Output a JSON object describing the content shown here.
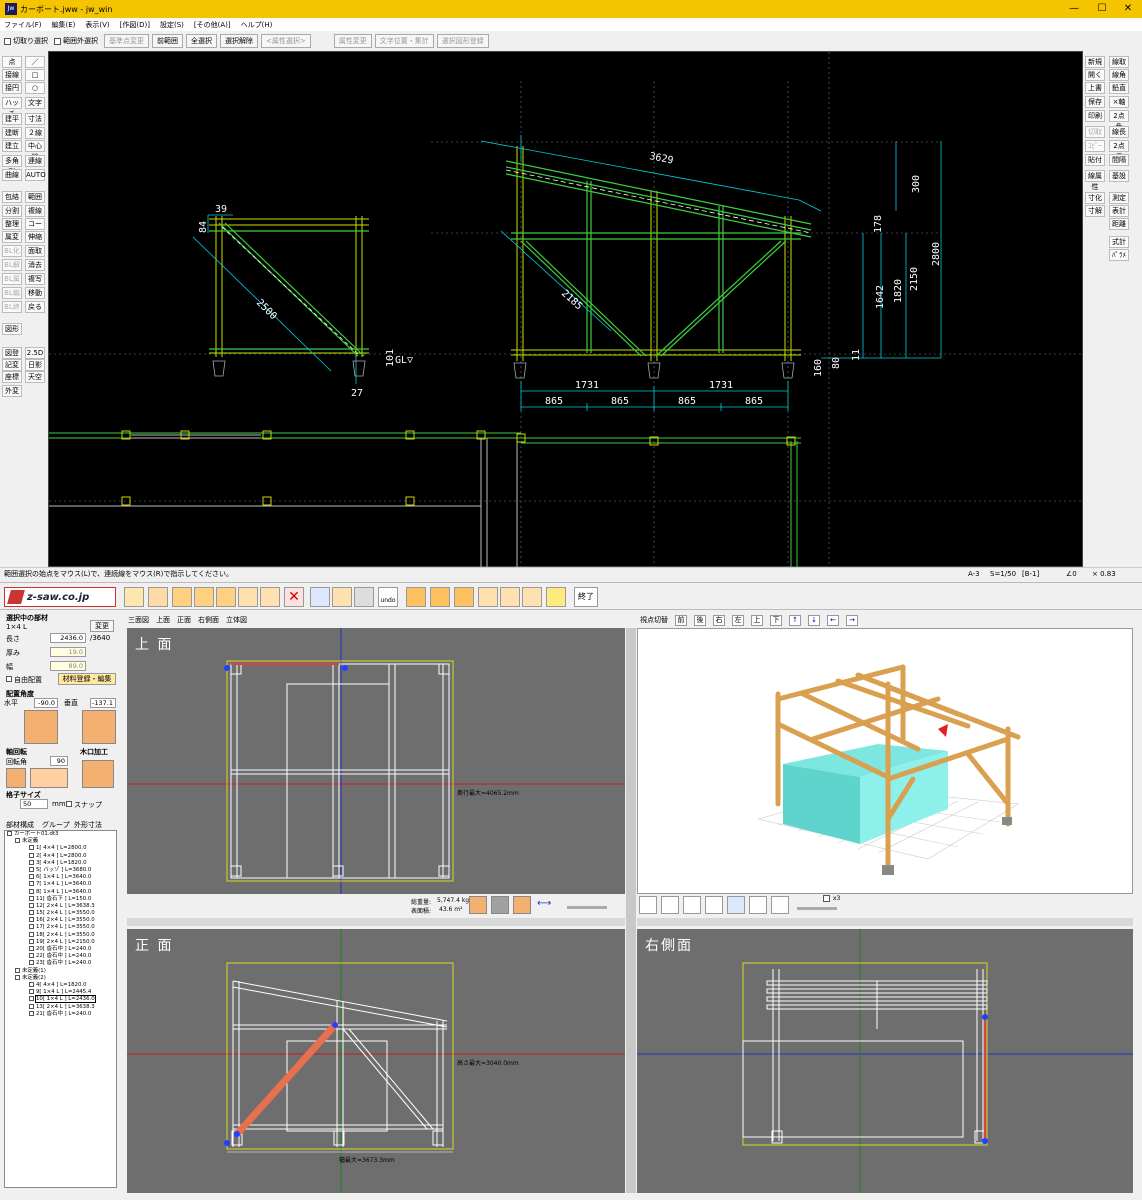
{
  "window": {
    "title": "カーボート.jww - jw_win",
    "min": "—",
    "max": "☐",
    "close": "✕"
  },
  "menu": [
    "ファイル(F)",
    "編集(E)",
    "表示(V)",
    "[作図(D)]",
    "設定(S)",
    "[その他(A)]",
    "ヘルプ(H)"
  ],
  "toolbar": {
    "check1": "切取り選択",
    "check2": "範囲外選択",
    "buttons": [
      "基準点変更",
      "前範囲",
      "全選択",
      "選択解除",
      "<属性選択>",
      "属性変更",
      "文字位置・集計",
      "選択図形登録"
    ]
  },
  "left_tools": [
    [
      "点",
      "／"
    ],
    [
      "接線",
      "□"
    ],
    [
      "接円",
      "○"
    ],
    [
      "ハッチ",
      "文字"
    ],
    [
      "建平",
      "寸法"
    ],
    [
      "建断",
      "２線"
    ],
    [
      "建立",
      "中心線"
    ],
    [
      "多角形",
      "連線"
    ],
    [
      "曲線",
      "AUTO"
    ],
    [
      "包絡",
      "範囲"
    ],
    [
      "分割",
      "複線"
    ],
    [
      "整理",
      "コーナー"
    ],
    [
      "属変",
      "伸縮"
    ],
    [
      "BL化",
      "面取"
    ],
    [
      "BL解",
      "消去"
    ],
    [
      "BL属",
      "複写"
    ],
    [
      "BL編",
      "移動"
    ],
    [
      "BL終",
      "戻る"
    ],
    [
      "図形",
      ""
    ],
    [
      "図登",
      "2.5D"
    ],
    [
      "記変",
      "日影"
    ],
    [
      "座標",
      "天空"
    ],
    [
      "外変",
      ""
    ]
  ],
  "right_tools": [
    [
      "新規",
      "線取"
    ],
    [
      "開く",
      "線角"
    ],
    [
      "上書",
      "鉛直"
    ],
    [
      "保存",
      "×軸"
    ],
    [
      "印刷",
      "2点角"
    ],
    [
      "切取",
      "線長"
    ],
    [
      "ｺﾋﾟｰ",
      "2点長"
    ],
    [
      "貼付",
      "間隔"
    ],
    [
      "線属性",
      "基設"
    ],
    [
      "寸化",
      "測定"
    ],
    [
      "寸解",
      "表計"
    ],
    [
      "",
      "距離"
    ],
    [
      "",
      "式計"
    ],
    [
      "",
      "ﾊﾟﾗﾒ"
    ]
  ],
  "cad_dims": {
    "d3629": "3629",
    "d39": "39",
    "d84": "84",
    "d2500": "2500",
    "d2185": "2185",
    "d300": "300",
    "d178": "178",
    "d2800": "2800",
    "d2150": "2150",
    "d1820": "1820",
    "d1642": "1642",
    "d101": "101",
    "d27": "27",
    "d1731a": "1731",
    "d1731b": "1731",
    "d865a": "865",
    "d865b": "865",
    "d865c": "865",
    "d865d": "865",
    "d80": "80",
    "d160": "160",
    "d11": "11",
    "gl": "GL▽"
  },
  "status": {
    "msg": "範囲選択の始点をマウス(L)で、連続線をマウス(R)で指示してください。",
    "paper": "A-3",
    "scale": "S=1/50",
    "layer": "[B-1]",
    "angle": "∠0",
    "zoom": "× 0.83"
  },
  "zsaw": {
    "logo": "z-saw.co.jp",
    "end": "終了",
    "undo": "undo"
  },
  "part": {
    "heading": "選択中の部材",
    "name": "1×4 L",
    "change": "変更",
    "len_label": "長さ",
    "len": "2436.0",
    "len_max": "/3640",
    "thick_label": "厚み",
    "thick": "19.0",
    "width_label": "幅",
    "width": "89.0",
    "free": "自由配置",
    "register": "材料登録・編集",
    "angle_heading": "配置角度",
    "h_label": "水平",
    "h_val": "-90.0",
    "v_label": "垂直",
    "v_val": "-137.1",
    "rot_heading": "軸回転",
    "rot_label": "回転角",
    "rot_val": "90",
    "cut_heading": "木口加工",
    "grid_heading": "格子サイズ",
    "grid_val": "50",
    "grid_unit": "mm",
    "snap": "スナップ"
  },
  "tabs": [
    "部材構成",
    "グループ",
    "外形寸法"
  ],
  "tree": [
    "カーポート01.dt3",
    "未定義",
    "1[ 4×4 ] L=2800.0",
    "2[ 4×4 ] L=2800.0",
    "3[ 4×4 ] L=1820.0",
    "5[ バッゾ ] L=3680.0",
    "6[ 1×4 L ] L=3640.0",
    "7[ 1×4 L ] L=3640.0",
    "8[ 1×4 L ] L=3640.0",
    "11[ 沓石下 ] L=150.0",
    "12[ 2×4 L ] L=3638.3",
    "15[ 2×4 L ] L=3550.0",
    "16[ 2×4 L ] L=3550.0",
    "17[ 2×4 L ] L=3550.0",
    "18[ 2×4 L ] L=3550.0",
    "19[ 2×4 L ] L=2150.0",
    "20[ 沓石中 ] L=240.0",
    "22[ 沓石中 ] L=240.0",
    "23[ 沓石中 ] L=240.0",
    "未定義(1)",
    "未定義(2)",
    "4[ 4×4 ] L=1820.0",
    "9[ 1×4 L ] L=2445.4",
    "10[ 1×4 L ] L=2436.0",
    "13[ 2×4 L ] L=3638.3",
    "21[ 沓石中 ] L=240.0"
  ],
  "view_tabs": [
    "三面図",
    "上面",
    "正面",
    "右側面",
    "立体図"
  ],
  "persp": {
    "label": "視点切替",
    "btns": [
      "前",
      "後",
      "右",
      "左",
      "上",
      "下"
    ],
    "x3": "x3"
  },
  "panes": {
    "top": "上 面",
    "front": "正 面",
    "side": "右側面"
  },
  "info": {
    "depth": "奥行最大=4065.2mm",
    "height": "高さ最大=3040.0mm",
    "width": "幅最大=3673.3mm",
    "weight_label": "総重量:",
    "weight": "5,747.4 kg",
    "area_label": "表面積:",
    "area": "43.6 m²"
  }
}
